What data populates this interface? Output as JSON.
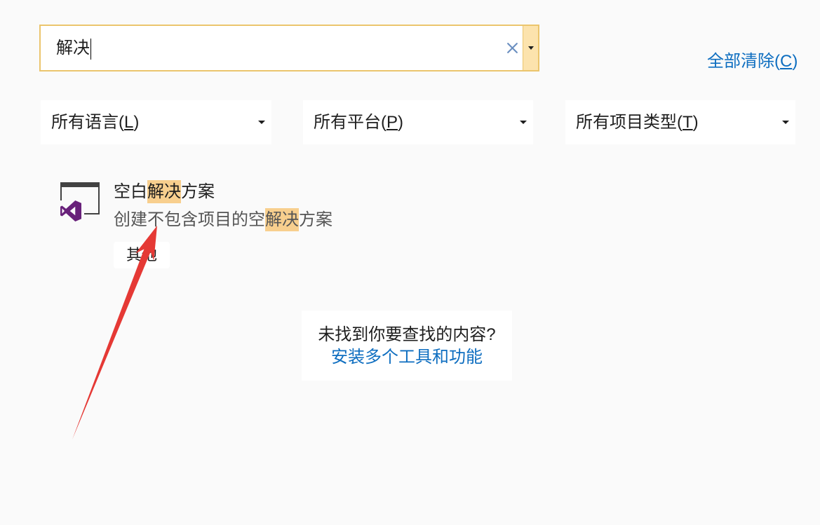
{
  "search": {
    "value": "解决"
  },
  "clear_all": {
    "label_before": "全部清除(",
    "access_key": "C",
    "label_after": ")"
  },
  "filters": [
    {
      "label_before": "所有语言(",
      "access_key": "L",
      "label_after": ")"
    },
    {
      "label_before": "所有平台(",
      "access_key": "P",
      "label_after": ")"
    },
    {
      "label_before": "所有项目类型(",
      "access_key": "T",
      "label_after": ")"
    }
  ],
  "results": [
    {
      "icon": "visual-studio-solution-icon",
      "title": {
        "before": "空白",
        "match": "解决",
        "after": "方案"
      },
      "description": {
        "before": "创建不包含项目的空",
        "match": "解决",
        "after": "方案"
      },
      "tags": [
        "其他"
      ]
    }
  ],
  "not_found": {
    "message": "未找到你要查找的内容?",
    "link": "安装多个工具和功能"
  },
  "icons": {
    "clear_search": "close-icon",
    "search_dropdown": "caret-down-icon",
    "filter_dropdown": "caret-down-icon",
    "annotation": "red-arrow"
  },
  "colors": {
    "background": "#fafafa",
    "accent_link": "#0e6ec0",
    "search_focus_border": "#ebc56d",
    "search_dropdown_fill": "#fce3ad",
    "match_highlight": "#f8cf8e",
    "clear_icon": "#6b8fc0",
    "vs_purple": "#68217a",
    "annotation_arrow": "#e53935"
  }
}
